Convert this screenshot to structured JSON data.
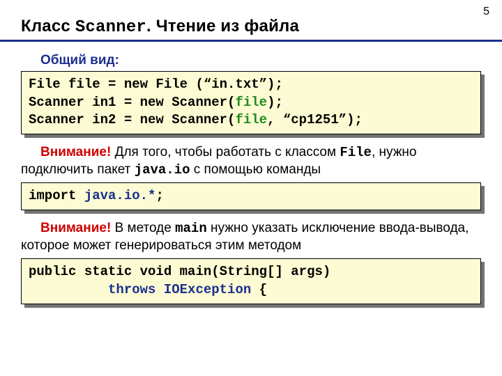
{
  "page_number": "5",
  "title_part1": "Класс ",
  "title_mono": "Scanner",
  "title_part2": ". Чтение из файла",
  "section_label": "Общий вид:",
  "code1": {
    "line1a": "File file = new File (“in.txt”);",
    "line2a": "Scanner in1 = new Scanner(",
    "line2b": "file",
    "line2c": ");",
    "line3a": "Scanner in2 = new Scanner(",
    "line3b": "file",
    "line3c": ", “cp1251”);"
  },
  "note1": {
    "attn": "Внимание!",
    "t1": " Для того, чтобы работать с классом ",
    "m1": "File",
    "t2": ", нужно подключить пакет ",
    "m2": "java.io",
    "t3": " с помощью команды"
  },
  "code2": {
    "a": "import ",
    "b": "java.io.*",
    "c": ";"
  },
  "note2": {
    "attn": "Внимание!",
    "t1": " В методе ",
    "m1": "main",
    "t2": " нужно указать исключение ввода-вывода, которое может генерироваться этим методом"
  },
  "code3": {
    "line1": "public static void main(String[] args)",
    "line2a": "          ",
    "line2b": "throws IOException ",
    "line2c": "{"
  }
}
